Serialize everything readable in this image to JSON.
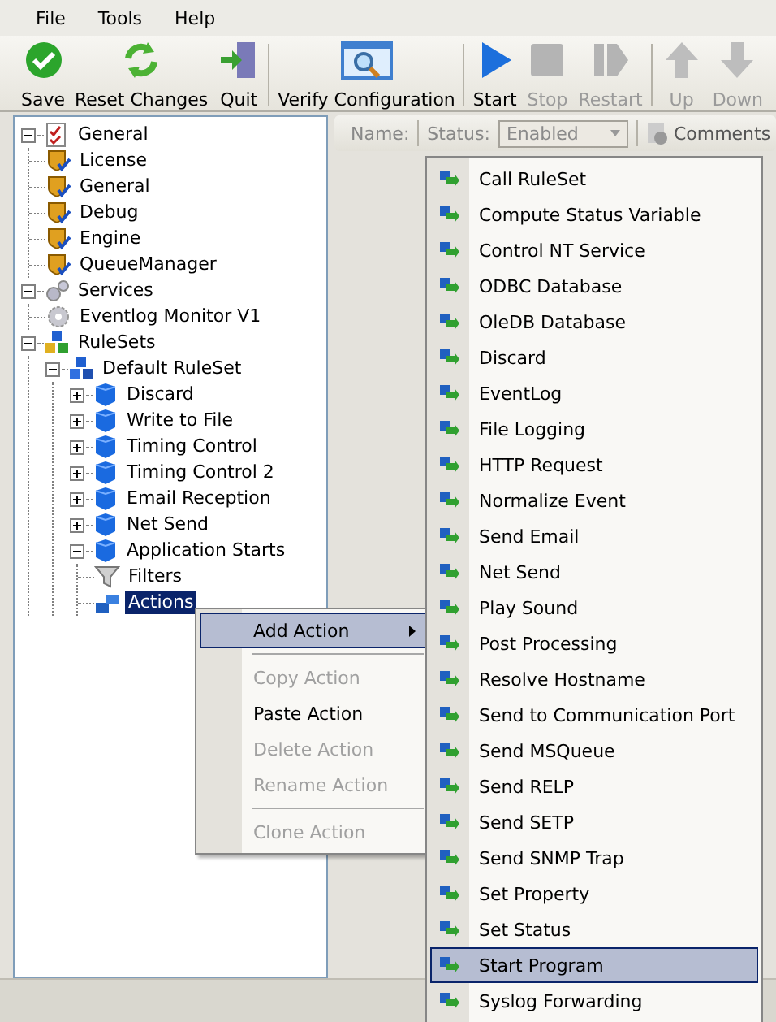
{
  "menu_bar": [
    {
      "label": "File"
    },
    {
      "label": "Tools"
    },
    {
      "label": "Help"
    }
  ],
  "toolbar": [
    [
      {
        "label": "Save",
        "disabled": false
      },
      {
        "label": "Reset Changes",
        "disabled": false
      },
      {
        "label": "Quit",
        "disabled": false
      }
    ],
    [
      {
        "label": "Verify Configuration",
        "disabled": false
      }
    ],
    [
      {
        "label": "Start",
        "disabled": false
      },
      {
        "label": "Stop",
        "disabled": true
      },
      {
        "label": "Restart",
        "disabled": true
      }
    ],
    [
      {
        "label": "Up",
        "disabled": true
      },
      {
        "label": "Down",
        "disabled": true
      }
    ]
  ],
  "tree": [
    {
      "label": "General",
      "kind": "section",
      "expanded": true,
      "selected": false,
      "children": [
        {
          "label": "License",
          "kind": "setting",
          "selected": false
        },
        {
          "label": "General",
          "kind": "setting",
          "selected": false
        },
        {
          "label": "Debug",
          "kind": "setting",
          "selected": false
        },
        {
          "label": "Engine",
          "kind": "setting",
          "selected": false
        },
        {
          "label": "QueueManager",
          "kind": "setting",
          "selected": false
        }
      ]
    },
    {
      "label": "Services",
      "kind": "services",
      "expanded": true,
      "selected": false,
      "children": [
        {
          "label": "Eventlog Monitor V1",
          "kind": "service",
          "selected": false
        }
      ]
    },
    {
      "label": "RuleSets",
      "kind": "rulesets",
      "expanded": true,
      "selected": false,
      "children": [
        {
          "label": "Default RuleSet",
          "kind": "ruleset",
          "expanded": true,
          "selected": false,
          "children": [
            {
              "label": "Discard",
              "kind": "rule",
              "expanded": false,
              "selected": false
            },
            {
              "label": "Write to File",
              "kind": "rule",
              "expanded": false,
              "selected": false
            },
            {
              "label": "Timing Control",
              "kind": "rule",
              "expanded": false,
              "selected": false
            },
            {
              "label": "Timing Control 2",
              "kind": "rule",
              "expanded": false,
              "selected": false
            },
            {
              "label": "Email Reception",
              "kind": "rule",
              "expanded": false,
              "selected": false
            },
            {
              "label": "Net Send",
              "kind": "rule",
              "expanded": false,
              "selected": false
            },
            {
              "label": "Application Starts",
              "kind": "rule",
              "expanded": true,
              "selected": false,
              "children": [
                {
                  "label": "Filters",
                  "kind": "filters",
                  "selected": false
                },
                {
                  "label": "Actions",
                  "kind": "actions",
                  "selected": true
                }
              ]
            }
          ]
        }
      ]
    }
  ],
  "properties_bar": {
    "name_label": "Name:",
    "status_label": "Status:",
    "status": {
      "value": "Enabled",
      "disabled": true
    },
    "comments": "Comments"
  },
  "context_menu": [
    [
      {
        "label": "Add Action",
        "kind": "submenu",
        "disabled": false,
        "selected": true
      }
    ],
    [
      {
        "label": "Copy Action",
        "kind": "item",
        "disabled": true,
        "selected": false
      },
      {
        "label": "Paste Action",
        "kind": "item",
        "disabled": false,
        "selected": false
      },
      {
        "label": "Delete Action",
        "kind": "item",
        "disabled": true,
        "selected": false
      },
      {
        "label": "Rename Action",
        "kind": "item",
        "disabled": true,
        "selected": false
      }
    ],
    [
      {
        "label": "Clone Action",
        "kind": "item",
        "disabled": true,
        "selected": false
      }
    ]
  ],
  "submenu": [
    {
      "label": "Call RuleSet",
      "selected": false
    },
    {
      "label": "Compute Status Variable",
      "selected": false
    },
    {
      "label": "Control NT Service",
      "selected": false
    },
    {
      "label": "ODBC Database",
      "selected": false
    },
    {
      "label": "OleDB Database",
      "selected": false
    },
    {
      "label": "Discard",
      "selected": false
    },
    {
      "label": "EventLog",
      "selected": false
    },
    {
      "label": "File Logging",
      "selected": false
    },
    {
      "label": "HTTP Request",
      "selected": false
    },
    {
      "label": "Normalize Event",
      "selected": false
    },
    {
      "label": "Send Email",
      "selected": false
    },
    {
      "label": "Net Send",
      "selected": false
    },
    {
      "label": "Play Sound",
      "selected": false
    },
    {
      "label": "Post Processing",
      "selected": false
    },
    {
      "label": "Resolve Hostname",
      "selected": false
    },
    {
      "label": "Send to Communication Port",
      "selected": false
    },
    {
      "label": "Send MSQueue",
      "selected": false
    },
    {
      "label": "Send RELP",
      "selected": false
    },
    {
      "label": "Send SETP",
      "selected": false
    },
    {
      "label": "Send SNMP Trap",
      "selected": false
    },
    {
      "label": "Set Property",
      "selected": false
    },
    {
      "label": "Set Status",
      "selected": false
    },
    {
      "label": "Start Program",
      "selected": true
    },
    {
      "label": "Syslog Forwarding",
      "selected": false
    }
  ]
}
